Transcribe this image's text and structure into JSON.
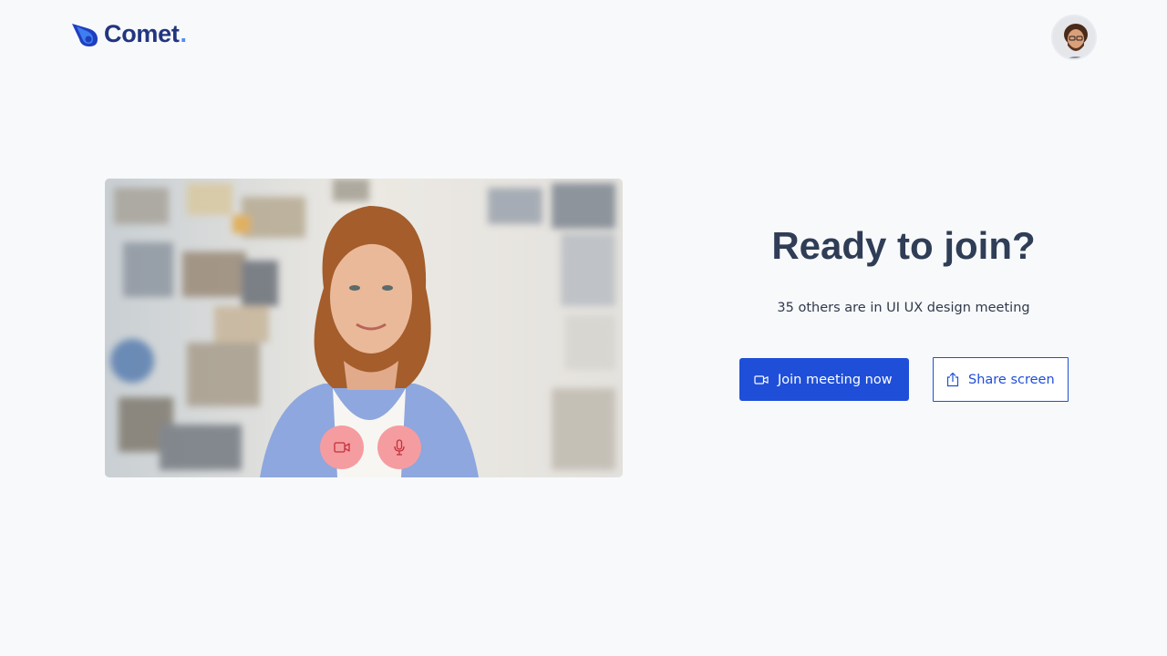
{
  "brand": {
    "name": "Comet",
    "dot": ".",
    "primary_color": "#22357f",
    "accent_color": "#4e8ff0"
  },
  "header": {
    "avatar_icon": "user-avatar"
  },
  "preview": {
    "camera_icon": "video-camera-icon",
    "mic_icon": "microphone-icon",
    "control_color": "#f59ca0"
  },
  "join": {
    "title": "Ready to join?",
    "subtitle": "35 others are in UI UX design meeting",
    "join_label": "Join meeting now",
    "share_label": "Share screen",
    "button_color": "#1f4fd8"
  }
}
